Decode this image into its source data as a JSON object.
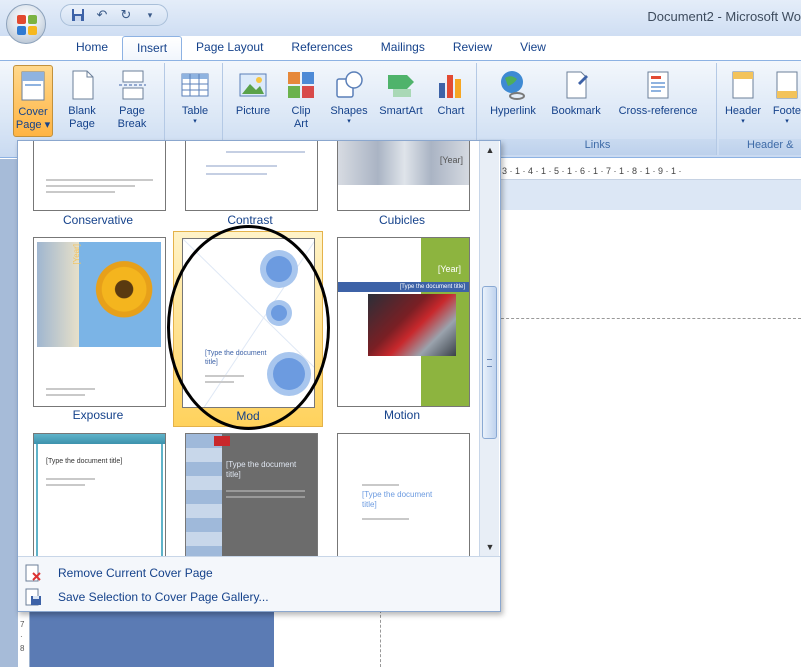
{
  "titlebar": {
    "document_title": "Document2 - Microsoft Wo"
  },
  "tabs": [
    "Home",
    "Insert",
    "Page Layout",
    "References",
    "Mailings",
    "Review",
    "View"
  ],
  "active_tab": "Insert",
  "ribbon": {
    "cover_page": {
      "line1": "Cover",
      "line2": "Page"
    },
    "blank_page": {
      "line1": "Blank",
      "line2": "Page"
    },
    "page_break": {
      "line1": "Page",
      "line2": "Break"
    },
    "table": {
      "label": "Table"
    },
    "picture": {
      "label": "Picture"
    },
    "clip_art": {
      "line1": "Clip",
      "line2": "Art"
    },
    "shapes": {
      "label": "Shapes"
    },
    "smartart": {
      "label": "SmartArt"
    },
    "chart": {
      "label": "Chart"
    },
    "hyperlink": {
      "label": "Hyperlink"
    },
    "bookmark": {
      "label": "Bookmark"
    },
    "cross_reference": {
      "label": "Cross-reference"
    },
    "header": {
      "label": "Header"
    },
    "footer": {
      "label": "Foote"
    },
    "group_links": "Links",
    "group_header": "Header &"
  },
  "ruler": {
    "marks": "3 · 1 · 4 · 1 · 5 · 1 · 6 · 1 · 7 · 1 · 8 · 1 · 9 · 1 ·"
  },
  "vruler": {
    "marks": "7 · 8"
  },
  "gallery": {
    "row1": [
      "Conservative",
      "Contrast",
      "Cubicles"
    ],
    "row2": [
      "Exposure",
      "Mod",
      "Motion"
    ],
    "selected": "Mod",
    "thumb_text": {
      "year": "[Year]",
      "doc_title": "[Type the document title]",
      "doc_title_short": "[Type the document",
      "doc_title_end": "title]"
    }
  },
  "menu": {
    "remove": "Remove Current Cover Page",
    "save": "Save Selection to Cover Page Gallery..."
  },
  "colors": {
    "accent": "#15428b",
    "motion_green": "#8db43f",
    "mod_blue": "#5b8fd6",
    "highlight": "#ffd25c"
  }
}
